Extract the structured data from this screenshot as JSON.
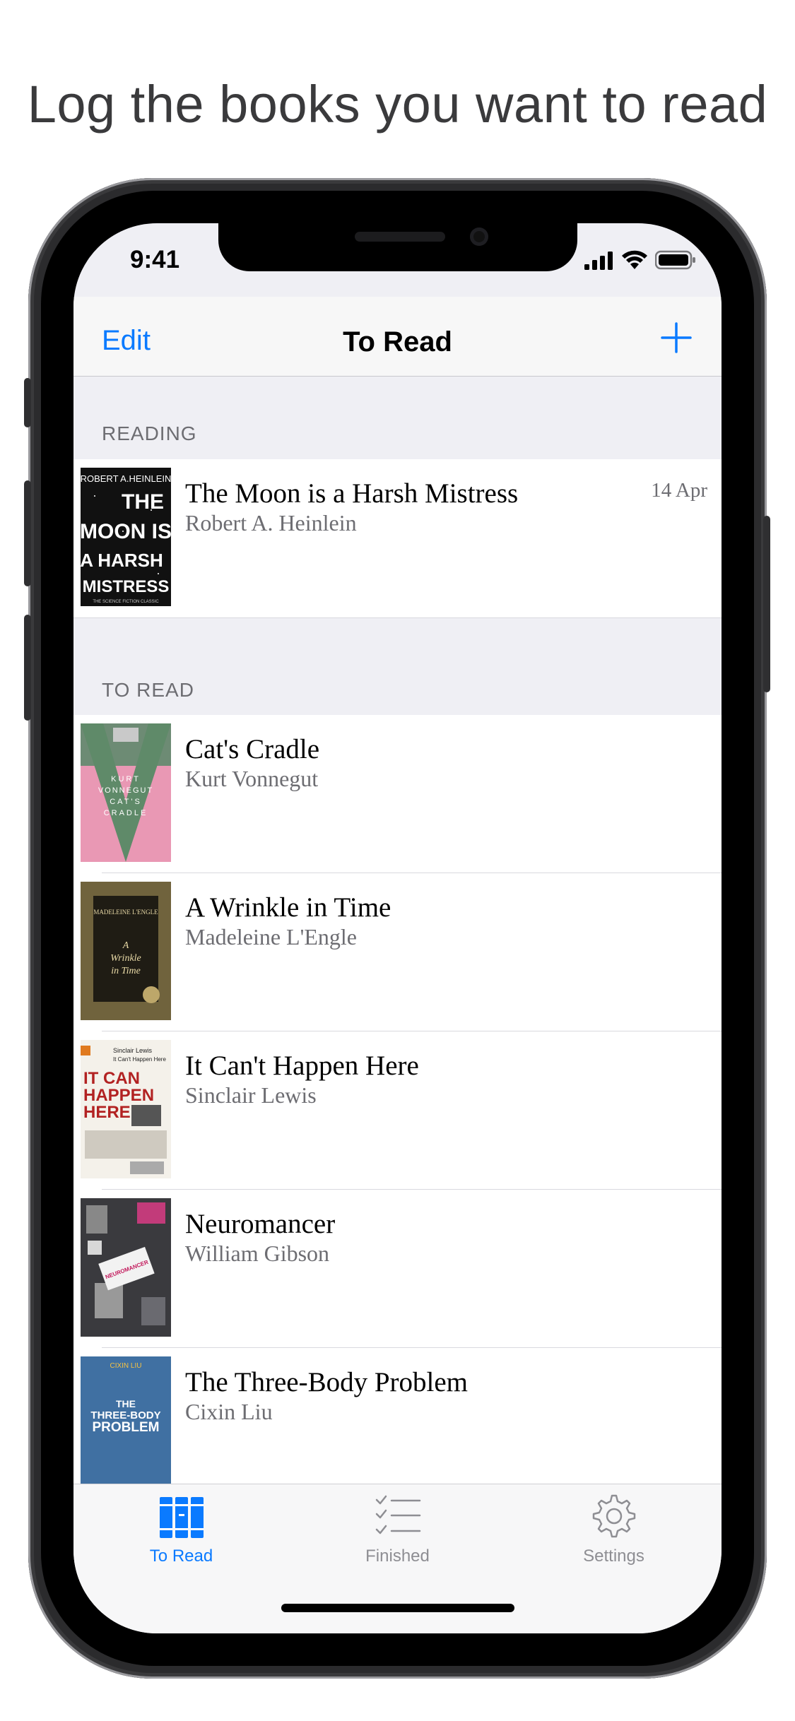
{
  "headline": "Log the books you want to read",
  "status_bar": {
    "time": "9:41"
  },
  "nav": {
    "edit_label": "Edit",
    "title": "To Read",
    "add_icon": "plus-icon"
  },
  "sections": [
    {
      "header": "READING",
      "rows": [
        {
          "title": "The Moon is a Harsh Mistress",
          "author": "Robert A. Heinlein",
          "date": "14 Apr"
        }
      ]
    },
    {
      "header": "TO READ",
      "rows": [
        {
          "title": "Cat's Cradle",
          "author": "Kurt Vonnegut"
        },
        {
          "title": "A Wrinkle in Time",
          "author": "Madeleine L'Engle"
        },
        {
          "title": "It Can't Happen Here",
          "author": "Sinclair Lewis"
        },
        {
          "title": "Neuromancer",
          "author": "William Gibson"
        },
        {
          "title": "The Three-Body Problem",
          "author": "Cixin Liu"
        }
      ]
    }
  ],
  "covers": {
    "moon": {
      "top_line": "ROBERT A.HEINLEIN",
      "lines": [
        "THE",
        "MOON IS",
        "A HARSH",
        "MISTRESS"
      ],
      "tagline": "THE SCIENCE FICTION CLASSIC"
    },
    "cats": {
      "lines": [
        "KURT",
        "VONNEGUT",
        "CAT'S",
        "CRADLE"
      ]
    },
    "wrinkle": {
      "author": "MADELEINE L'ENGLE",
      "lines": [
        "A",
        "Wrinkle",
        "in Time"
      ]
    },
    "happen": {
      "author": "Sinclair Lewis",
      "subtitle": "It Can't Happen Here",
      "lines": [
        "IT CAN",
        "HAPPEN",
        "HERE"
      ]
    },
    "neuro": {
      "label": "NEUROMANCER"
    },
    "three": {
      "author": "CIXIN LIU",
      "lines": [
        "THE",
        "THREE-BODY",
        "PROBLEM"
      ]
    }
  },
  "tabbar": {
    "items": [
      {
        "label": "To Read",
        "icon": "books-icon",
        "active": true
      },
      {
        "label": "Finished",
        "icon": "checklist-icon",
        "active": false
      },
      {
        "label": "Settings",
        "icon": "gear-icon",
        "active": false
      }
    ]
  },
  "colors": {
    "accent": "#0a7aff",
    "inactive": "#8e8e93",
    "group_bg": "#efeff4"
  }
}
